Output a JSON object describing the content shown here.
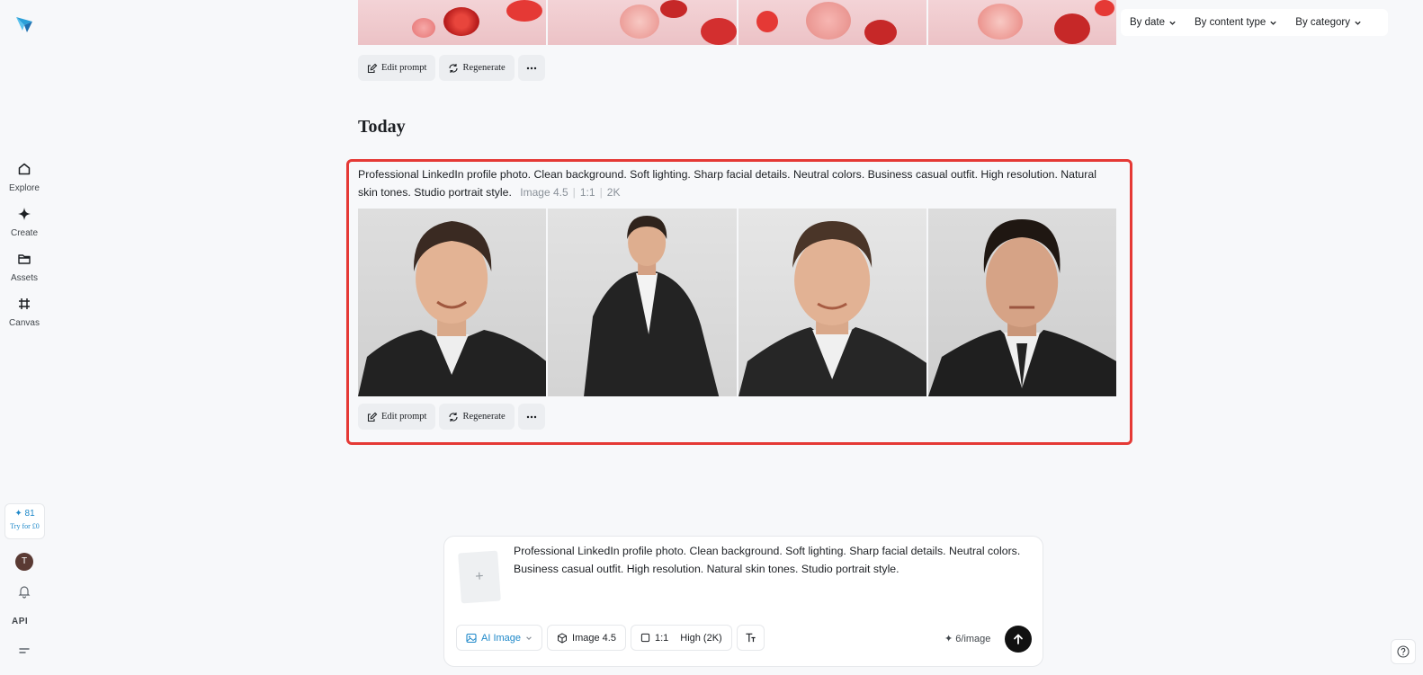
{
  "sidebar": {
    "nav": [
      {
        "label": "Explore",
        "icon": "home-icon"
      },
      {
        "label": "Create",
        "icon": "diamond-icon"
      },
      {
        "label": "Assets",
        "icon": "folder-icon"
      },
      {
        "label": "Canvas",
        "icon": "grid-icon"
      }
    ],
    "credits": "81",
    "try_label": "Try for £0",
    "avatar_initial": "T",
    "api_label": "API"
  },
  "filters": [
    "By date",
    "By content type",
    "By category"
  ],
  "actions": {
    "edit": "Edit prompt",
    "regenerate": "Regenerate"
  },
  "section": {
    "title": "Today"
  },
  "generation": {
    "prompt": "Professional LinkedIn profile photo. Clean background. Soft lighting. Sharp facial details. Neutral colors. Business casual outfit. High resolution. Natural skin tones. Studio portrait style.",
    "model": "Image 4.5",
    "ratio": "1:1",
    "quality": "2K"
  },
  "composer": {
    "text": "Professional LinkedIn profile photo. Clean background. Soft lighting. Sharp facial details. Neutral colors. Business casual outfit. High resolution. Natural skin tones. Studio portrait style.",
    "mode": "AI Image",
    "model": "Image 4.5",
    "ratio": "1:1",
    "quality": "High (2K)",
    "cost": "6/image"
  },
  "colors": {
    "accent": "#1e88c9",
    "highlight": "#e53935"
  }
}
